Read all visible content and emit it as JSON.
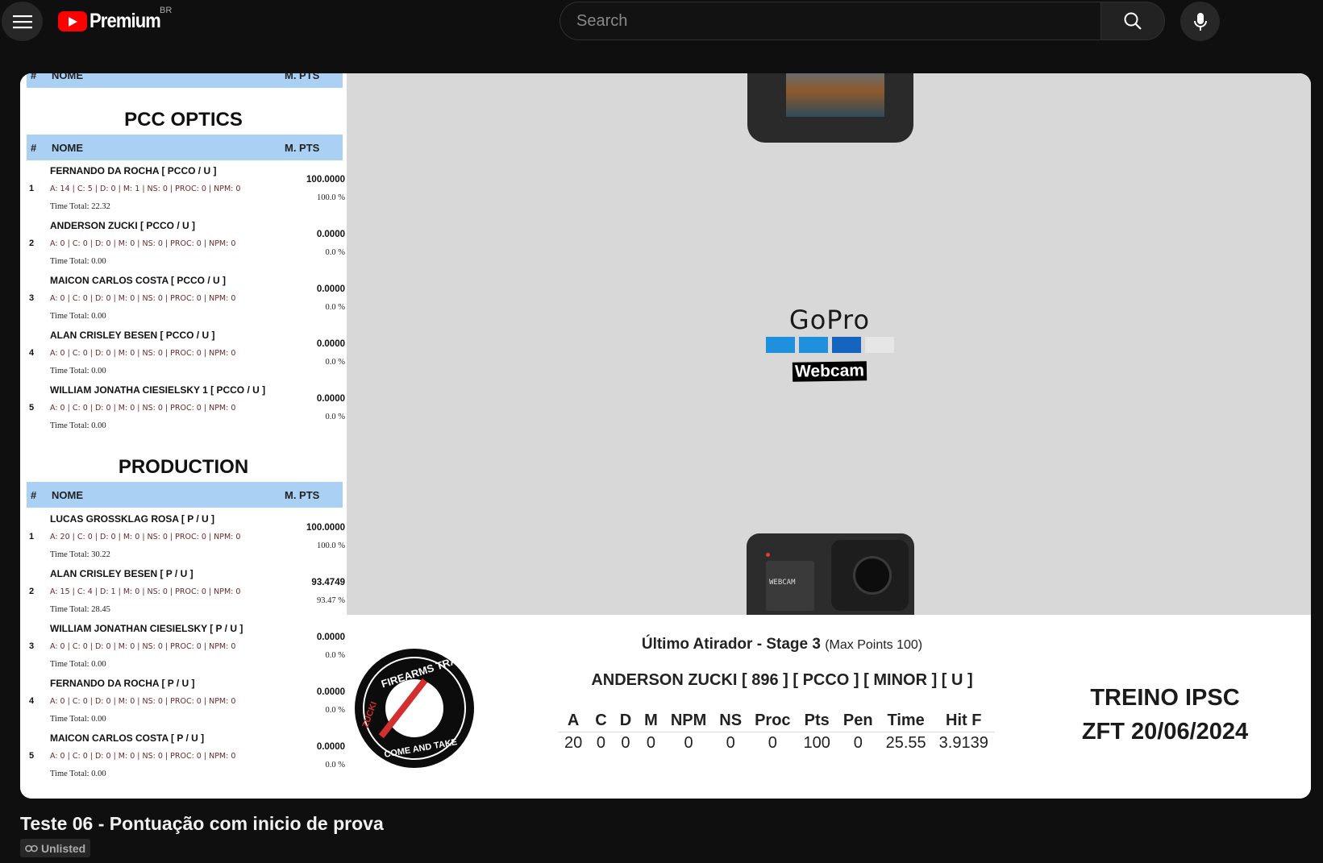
{
  "header": {
    "logo_text": "Premium",
    "region": "BR",
    "search_placeholder": "Search",
    "icons": [
      "menu-icon",
      "youtube-logo-icon",
      "search-icon",
      "mic-icon"
    ]
  },
  "scoreboard": {
    "col_hash": "#",
    "col_name": "NOME",
    "col_pts": "M. PTS",
    "categories": [
      {
        "title": "PCC OPTICS",
        "entries": [
          {
            "pos": "1",
            "name": "FERNANDO DA ROCHA [ PCCO / U ]",
            "stats": "A: 14 | C: 5 | D: 0 | M: 1 | NS: 0 | PROC: 0 | NPM: 0",
            "total": "Time Total: 22.32",
            "pts": "100.0000",
            "pct": "100.0 %"
          },
          {
            "pos": "2",
            "name": "ANDERSON ZUCKI [ PCCO / U ]",
            "stats": "A: 0 | C: 0 | D: 0 | M: 0 | NS: 0 | PROC: 0 | NPM: 0",
            "total": "Time Total: 0.00",
            "pts": "0.0000",
            "pct": "0.0 %"
          },
          {
            "pos": "3",
            "name": "MAICON CARLOS COSTA [ PCCO / U ]",
            "stats": "A: 0 | C: 0 | D: 0 | M: 0 | NS: 0 | PROC: 0 | NPM: 0",
            "total": "Time Total: 0.00",
            "pts": "0.0000",
            "pct": "0.0 %"
          },
          {
            "pos": "4",
            "name": "ALAN CRISLEY BESEN [ PCCO / U ]",
            "stats": "A: 0 | C: 0 | D: 0 | M: 0 | NS: 0 | PROC: 0 | NPM: 0",
            "total": "Time Total: 0.00",
            "pts": "0.0000",
            "pct": "0.0 %"
          },
          {
            "pos": "5",
            "name": "WILLIAM JONATHA CIESIELSKY 1 [ PCCO / U ]",
            "stats": "A: 0 | C: 0 | D: 0 | M: 0 | NS: 0 | PROC: 0 | NPM: 0",
            "total": "Time Total: 0.00",
            "pts": "0.0000",
            "pct": "0.0 %"
          }
        ]
      },
      {
        "title": "PRODUCTION",
        "entries": [
          {
            "pos": "1",
            "name": "LUCAS GROSSKLAG ROSA [ P / U ]",
            "stats": "A: 20 | C: 0 | D: 0 | M: 0 | NS: 0 | PROC: 0 | NPM: 0",
            "total": "Time Total: 30.22",
            "pts": "100.0000",
            "pct": "100.0 %"
          },
          {
            "pos": "2",
            "name": "ALAN CRISLEY BESEN [ P / U ]",
            "stats": "A: 15 | C: 4 | D: 1 | M: 0 | NS: 0 | PROC: 0 | NPM: 0",
            "total": "Time Total: 28.45",
            "pts": "93.4749",
            "pct": "93.47 %"
          },
          {
            "pos": "3",
            "name": "WILLIAM JONATHAN CIESIELSKY [ P / U ]",
            "stats": "A: 0 | C: 0 | D: 0 | M: 0 | NS: 0 | PROC: 0 | NPM: 0",
            "total": "Time Total: 0.00",
            "pts": "0.0000",
            "pct": "0.0 %"
          },
          {
            "pos": "4",
            "name": "FERNANDO DA ROCHA [ P / U ]",
            "stats": "A: 0 | C: 0 | D: 0 | M: 0 | NS: 0 | PROC: 0 | NPM: 0",
            "total": "Time Total: 0.00",
            "pts": "0.0000",
            "pct": "0.0 %"
          },
          {
            "pos": "5",
            "name": "MAICON CARLOS COSTA [ P / U ]",
            "stats": "A: 0 | C: 0 | D: 0 | M: 0 | NS: 0 | PROC: 0 | NPM: 0",
            "total": "Time Total: 0.00",
            "pts": "0.0000",
            "pct": "0.0 %"
          }
        ]
      }
    ]
  },
  "video": {
    "brand_text": "GoPro",
    "brand_bar_colors": [
      "#1e90dd",
      "#1e90dd",
      "#1565c0",
      "#e6e6e6"
    ],
    "webcam_label": "Webcam",
    "camera_label": "WEBCAM"
  },
  "band": {
    "badge_text_top": "FIREARMS TRAINING",
    "badge_text_bottom": "COME AND TAKE",
    "badge_text_side": "ZUCKI",
    "last_title": "Último Atirador - Stage 3",
    "last_subtitle": "(Max Points 100)",
    "shooter": "ANDERSON ZUCKI [ 896 ] [ PCCO ] [ MINOR ] [ U ]",
    "columns": [
      "A",
      "C",
      "D",
      "M",
      "NPM",
      "NS",
      "Proc",
      "Pts",
      "Pen",
      "Time",
      "Hit F"
    ],
    "values": [
      "20",
      "0",
      "0",
      "0",
      "0",
      "0",
      "0",
      "100",
      "0",
      "25.55",
      "3.9139"
    ],
    "event_line1": "TREINO IPSC",
    "event_line2": "ZFT 20/06/2024"
  },
  "below": {
    "title": "Teste 06 - Pontuação com inicio de prova",
    "unlisted": "Unlisted"
  },
  "colors": {
    "accent_red": "#ff0000",
    "header_row_blue": "#aad0f4",
    "page_bg": "#0f0f0f"
  }
}
